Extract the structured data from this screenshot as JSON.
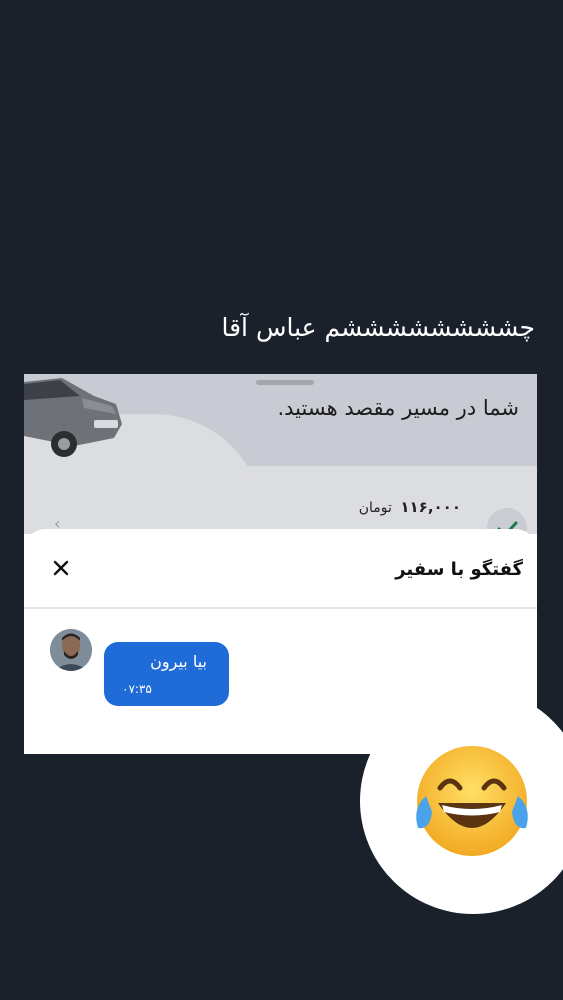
{
  "story": {
    "caption": "چششششششششم عباس آقا"
  },
  "ride": {
    "route_status": "شما در مسیر مقصد هستید.",
    "fare_amount": "۱۱۶,۰۰۰",
    "fare_currency": "تومان"
  },
  "chat": {
    "title": "گفتگو با سفیر",
    "messages": [
      {
        "text": "بیا بیرون",
        "time": "۰۷:۳۵"
      }
    ]
  },
  "colors": {
    "background": "#1a212b",
    "bubble": "#1f6bd8"
  }
}
